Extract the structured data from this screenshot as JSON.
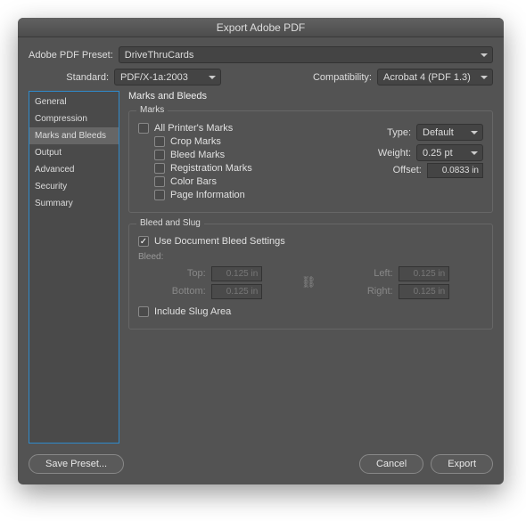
{
  "window": {
    "title": "Export Adobe PDF"
  },
  "preset": {
    "label": "Adobe PDF Preset:",
    "value": "DriveThruCards"
  },
  "standard": {
    "label": "Standard:",
    "value": "PDF/X-1a:2003"
  },
  "compat": {
    "label": "Compatibility:",
    "value": "Acrobat 4 (PDF 1.3)"
  },
  "sidebar": {
    "items": [
      {
        "label": "General"
      },
      {
        "label": "Compression"
      },
      {
        "label": "Marks and Bleeds"
      },
      {
        "label": "Output"
      },
      {
        "label": "Advanced"
      },
      {
        "label": "Security"
      },
      {
        "label": "Summary"
      }
    ],
    "selected_index": 2
  },
  "panel": {
    "title": "Marks and Bleeds"
  },
  "marks": {
    "legend": "Marks",
    "all": "All Printer's Marks",
    "crop": "Crop Marks",
    "bleed": "Bleed Marks",
    "reg": "Registration Marks",
    "color": "Color Bars",
    "page": "Page Information",
    "type_label": "Type:",
    "type_value": "Default",
    "weight_label": "Weight:",
    "weight_value": "0.25 pt",
    "offset_label": "Offset:",
    "offset_value": "0.0833 in"
  },
  "bleed": {
    "legend": "Bleed and Slug",
    "use_doc": "Use Document Bleed Settings",
    "use_doc_checked": true,
    "heading": "Bleed:",
    "top_label": "Top:",
    "top_value": "0.125 in",
    "bottom_label": "Bottom:",
    "bottom_value": "0.125 in",
    "left_label": "Left:",
    "left_value": "0.125 in",
    "right_label": "Right:",
    "right_value": "0.125 in",
    "slug": "Include Slug Area"
  },
  "footer": {
    "save_preset": "Save Preset...",
    "cancel": "Cancel",
    "export": "Export"
  }
}
